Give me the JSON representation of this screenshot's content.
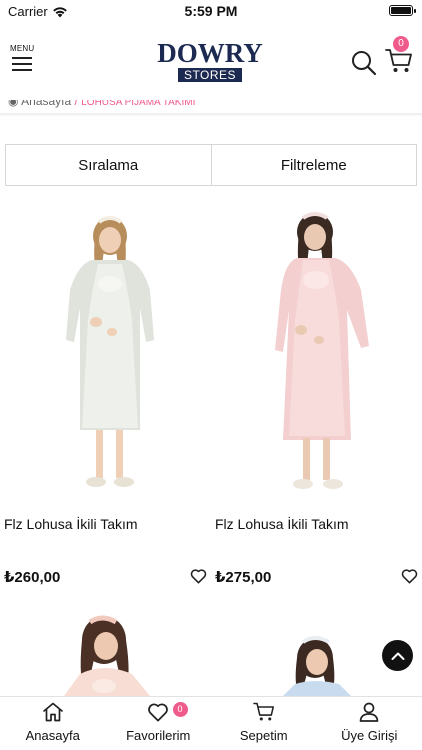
{
  "status_bar": {
    "carrier": "Carrier",
    "time": "5:59 PM"
  },
  "header": {
    "menu_label": "MENU",
    "logo_brand": "DOWRY",
    "logo_sub": "STORES",
    "cart_count": "0"
  },
  "breadcrumb": {
    "home": "Anasayfa",
    "separator": "/",
    "current": "LOHUSA PİJAMA TAKIMI"
  },
  "controls": {
    "sort_label": "Sıralama",
    "filter_label": "Filtreleme"
  },
  "products": [
    {
      "name": "Flz Lohusa İkili Takım",
      "price": "₺260,00",
      "color": "#e9ece6"
    },
    {
      "name": "Flz Lohusa İkili Takım",
      "price": "₺275,00",
      "color": "#f6d6d6"
    },
    {
      "name": "",
      "price": "",
      "color": "#f7ddd3"
    },
    {
      "name": "",
      "price": "",
      "color": "#c9dcef"
    }
  ],
  "tabbar": {
    "home_label": "Anasayfa",
    "favorites_label": "Favorilerim",
    "favorites_count": "0",
    "cart_label": "Sepetim",
    "account_label": "Üye Girişi"
  },
  "icons": {
    "menu": "hamburger-icon",
    "search": "search-icon",
    "cart": "cart-icon",
    "favorite": "heart-icon",
    "scroll_top": "chevron-up-icon"
  },
  "colors": {
    "brand": "#1c2a52",
    "accent": "#ef5b8a"
  }
}
